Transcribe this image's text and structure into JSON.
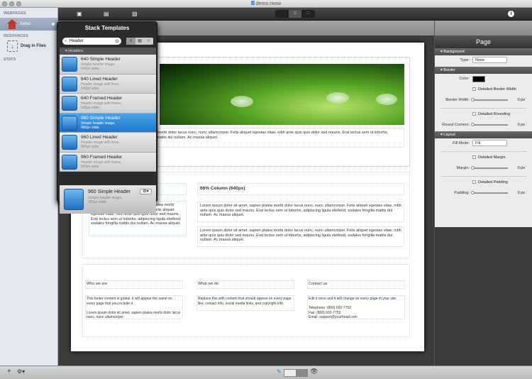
{
  "window": {
    "title": "demo.rwsw"
  },
  "sidebar": {
    "webpages_heading": "WEBPAGES",
    "page_name": "demo",
    "resources_heading": "RESOURCES",
    "drag_label": "Drag in Files",
    "stats_heading": "STATS"
  },
  "popover": {
    "title": "Stack Templates",
    "search_value": "Header",
    "group": "Headers",
    "items": [
      {
        "name": "640 Simple Header",
        "desc1": "Simple header image,",
        "desc2": "640px wide."
      },
      {
        "name": "640 Lined Header",
        "desc1": "Header image with lines,",
        "desc2": "640px wide."
      },
      {
        "name": "640 Framed Header",
        "desc1": "Header image with frame,",
        "desc2": "640px wide."
      },
      {
        "name": "960 Simple Header",
        "desc1": "Simple header image,",
        "desc2": "960px wide."
      },
      {
        "name": "960 Lined Header",
        "desc1": "Header image with lines,",
        "desc2": "960px wide."
      },
      {
        "name": "960 Framed Header",
        "desc1": "Header image with frame,",
        "desc2": "960px wide."
      }
    ],
    "selected_index": 3,
    "detail": {
      "name": "960 Simple Header",
      "desc1": "Simple header image,",
      "desc2": "960px wide."
    }
  },
  "page": {
    "header_text": "Lorem ipsum dolor sit amet, sapien platea morbi dolor lacus nunc, nunc ullamcorper. Felis aliquet egestas vitae, nibh ante quis quis dolor sed mauris. Erat lectus sem ut lobortis, adipiscing ligula eleifend, sodales fringilla mattis dui nullam. Ac massa aliquet.",
    "left_col_text": "Lorem ipsum dolor sit amet, sapien platea morbi dolor lacus nunc, nunc ullamcorper. Felis aliquet egestas vitae, nibh ante quis quis dolor sed mauris. Erat lectus sem ut lobortis, adipiscing ligula eleifend, sodales fringilla mattis dui nullam. Ac massa aliquet.",
    "right_col_heading": "66% Column (640px)",
    "right_col_text1": "Lorem ipsum dolor sit amet, sapien platea morbi dolor lacus nunc, nunc ullamcorper. Felis aliquet egestas vitae, nibh ante quis quis dolor sed mauris. Erat lectus sem ut lobortis, adipiscing ligula eleifend, sodales fringilla mattis dui nullam. Ac massa aliquet.",
    "right_col_text2": "Lorem ipsum dolor sit amet, sapien platea morbi dolor lacus nunc, nunc ullamcorper. Felis aliquet egestas vitae, nibh ante quis quis dolor sed mauris. Erat lectus sem ut lobortis, adipiscing ligula eleifend, sodales fringilla mattis dui nullam. Ac massa aliquet.",
    "footer": [
      {
        "heading": "Who we are",
        "p1": "This footer content is global. it will appear the same on every page that you include it.",
        "p2": "Lorem ipsum dolor sit amet, sapien platea morbi dolor lacus nunc, nunc ullamcorper."
      },
      {
        "heading": "What we do",
        "p1": "Replace this with content that should appear on every page like, contact info, social media links, and copyright info.",
        "p2": ""
      },
      {
        "heading": "Contact us",
        "p1": "Edit it once and it will change on every page in your site.",
        "p2": "Telephone: (800) 692-7753\nFax: (800) 692-7753\nEmail: support@yourhead.com"
      }
    ]
  },
  "inspector": {
    "title": "Page",
    "background": {
      "heading": "Background",
      "type_label": "Type:",
      "type_value": "None"
    },
    "border": {
      "heading": "Border",
      "color_label": "Color:",
      "color": "#000000",
      "detailed_width": "Detailed Border Width",
      "width_label": "Border Width:",
      "width_value": "0 px",
      "detailed_rounding": "Detailed Rounding",
      "corners_label": "Round Corners:",
      "corners_value": "0 px"
    },
    "layout": {
      "heading": "Layout",
      "fill_label": "Fill Mode:",
      "fill_value": "Fill",
      "detailed_margin": "Detailed Margin",
      "margin_label": "Margin:",
      "margin_value": "0 px",
      "detailed_padding": "Detailed Padding",
      "padding_label": "Padding:",
      "padding_value": "0 px"
    }
  }
}
